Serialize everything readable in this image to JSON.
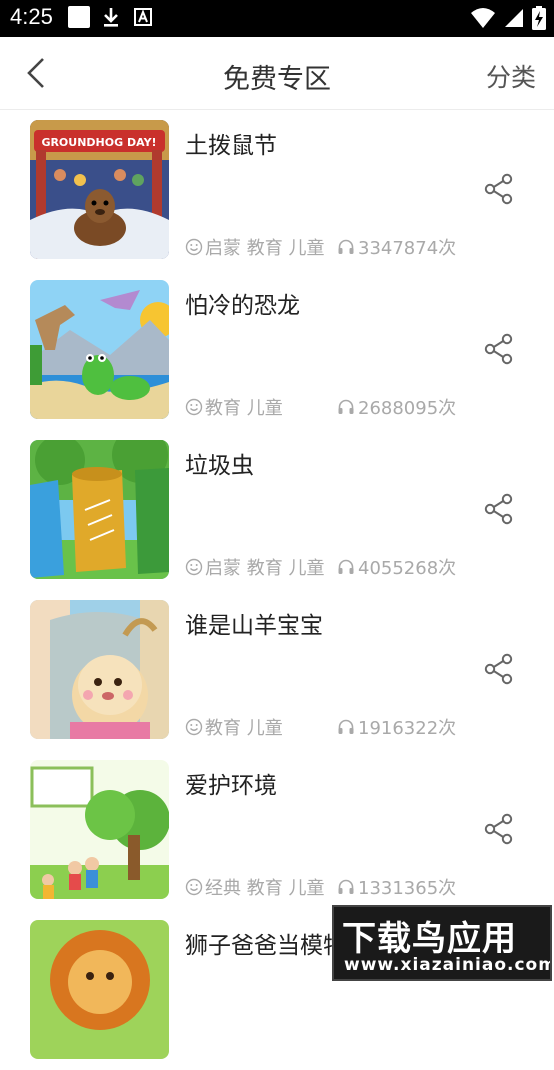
{
  "status_bar": {
    "time": "4:25"
  },
  "header": {
    "title": "免费专区",
    "category_label": "分类"
  },
  "items": [
    {
      "title": "土拨鼠节",
      "tags": "启蒙 教育 儿童",
      "plays": "3347874次"
    },
    {
      "title": "怕冷的恐龙",
      "tags": "教育 儿童",
      "plays": "2688095次"
    },
    {
      "title": "垃圾虫",
      "tags": "启蒙 教育 儿童",
      "plays": "4055268次"
    },
    {
      "title": "谁是山羊宝宝",
      "tags": "教育 儿童",
      "plays": "1916322次"
    },
    {
      "title": "爱护环境",
      "tags": "经典 教育 儿童",
      "plays": "1331365次"
    },
    {
      "title": "狮子爸爸当模特",
      "tags": "",
      "plays": ""
    }
  ],
  "thumb_text": {
    "groundhog_banner": "GROUNDHOG DAY!"
  },
  "watermark": {
    "main": "下载鸟应用",
    "url": "www.xiazainiao.com"
  },
  "colors": {
    "meta_text": "#a9a9a9",
    "title_text": "#222222",
    "share_icon": "#666666"
  }
}
